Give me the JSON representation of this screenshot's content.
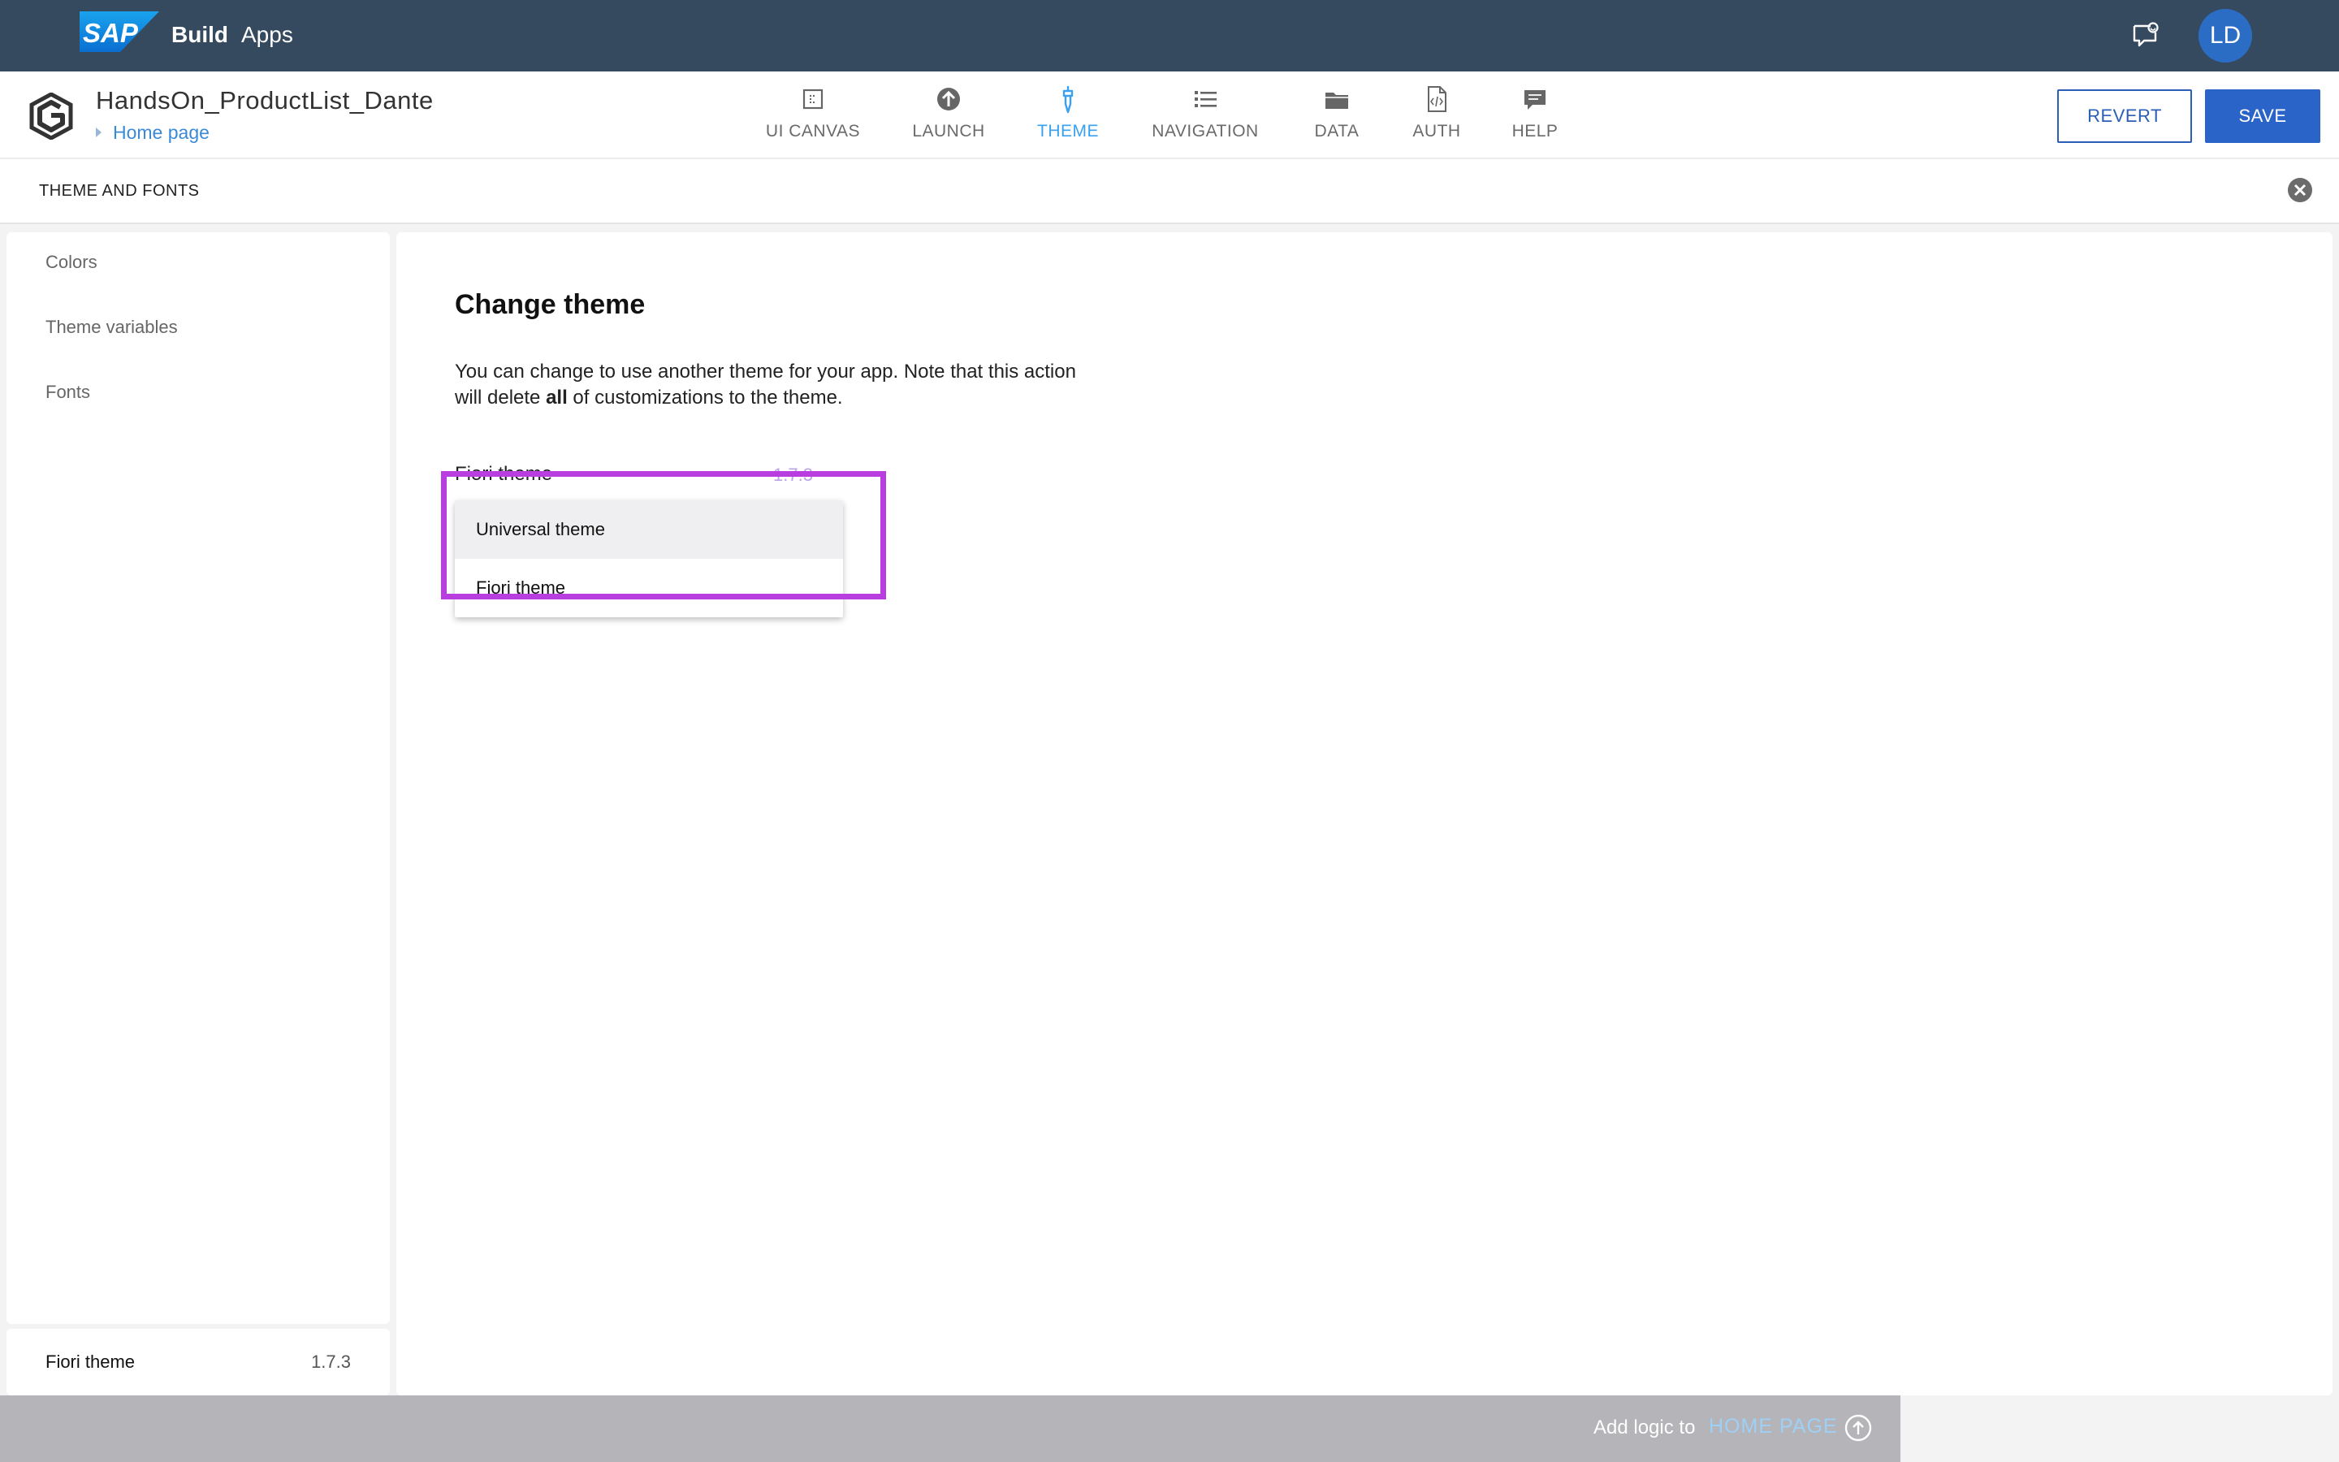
{
  "shell": {
    "product_bold": "Build",
    "product_name": "Apps",
    "avatar_initials": "LD",
    "brand_color": "#354a5f"
  },
  "app": {
    "title": "HandsOn_ProductList_Dante",
    "breadcrumb": "Home page",
    "nav": [
      {
        "label": "UI CANVAS",
        "icon": "canvas-icon"
      },
      {
        "label": "LAUNCH",
        "icon": "launch-icon"
      },
      {
        "label": "THEME",
        "icon": "theme-brush-icon",
        "active": true
      },
      {
        "label": "NAVIGATION",
        "icon": "list-icon"
      },
      {
        "label": "DATA",
        "icon": "folder-icon"
      },
      {
        "label": "AUTH",
        "icon": "code-file-icon"
      },
      {
        "label": "HELP",
        "icon": "chat-bubble-icon"
      }
    ],
    "revert_label": "REVERT",
    "save_label": "SAVE"
  },
  "panel": {
    "title": "THEME AND FONTS"
  },
  "sidebar": {
    "items": [
      "Colors",
      "Theme variables",
      "Fonts"
    ],
    "footer_name": "Fiori theme",
    "footer_version": "1.7.3"
  },
  "main": {
    "heading": "Change theme",
    "desc_part1": "You can change to use another theme for your app. Note that this action will delete ",
    "desc_bold": "all",
    "desc_part2": " of customizations to the theme.",
    "select_value": "Fiori theme",
    "select_version": "1.7.3",
    "options": [
      "Universal theme",
      "Fiori theme"
    ],
    "highlight_color": "#b83ee0"
  },
  "logicbar": {
    "prefix": "Add logic to",
    "target": "HOME PAGE"
  }
}
